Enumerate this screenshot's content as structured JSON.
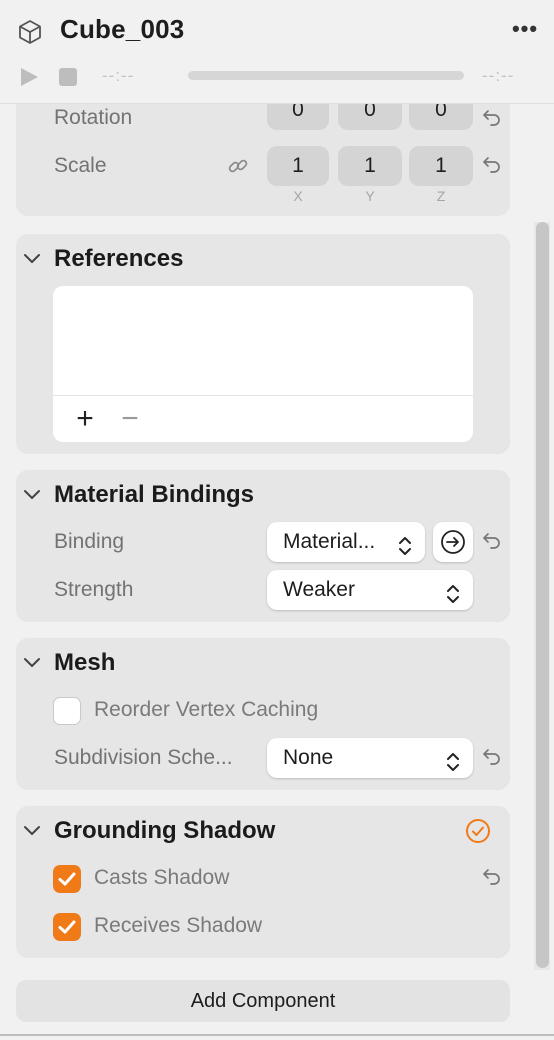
{
  "header": {
    "title": "Cube_003",
    "more_label": "•••",
    "time_start": "--:--",
    "time_end": "--:--"
  },
  "transform": {
    "rotation_label": "Rotation",
    "rotation_values": [
      "0",
      "0",
      "0"
    ],
    "scale_label": "Scale",
    "scale_values": [
      "1",
      "1",
      "1"
    ],
    "axes": [
      "X",
      "Y",
      "Z"
    ]
  },
  "references": {
    "title": "References",
    "add_label": "+",
    "remove_label": "−"
  },
  "material_bindings": {
    "title": "Material Bindings",
    "binding_label": "Binding",
    "binding_value": "Material...",
    "strength_label": "Strength",
    "strength_value": "Weaker"
  },
  "mesh": {
    "title": "Mesh",
    "reorder_label": "Reorder Vertex Caching",
    "reorder_checked": false,
    "subdivision_label": "Subdivision Sche...",
    "subdivision_value": "None"
  },
  "grounding_shadow": {
    "title": "Grounding Shadow",
    "enabled": true,
    "casts_label": "Casts Shadow",
    "casts_checked": true,
    "receives_label": "Receives Shadow",
    "receives_checked": true
  },
  "footer": {
    "add_component_label": "Add Component"
  },
  "colors": {
    "accent": "#f07a18",
    "card": "#e6e6e6",
    "background": "#f1f1f1"
  },
  "icons": [
    "cube-icon",
    "play-icon",
    "stop-icon",
    "chevron-down-icon",
    "link-icon",
    "reset-icon",
    "arrow-right-circle-icon",
    "updown-chevron-icon",
    "check-circle-icon",
    "checkmark-icon"
  ]
}
